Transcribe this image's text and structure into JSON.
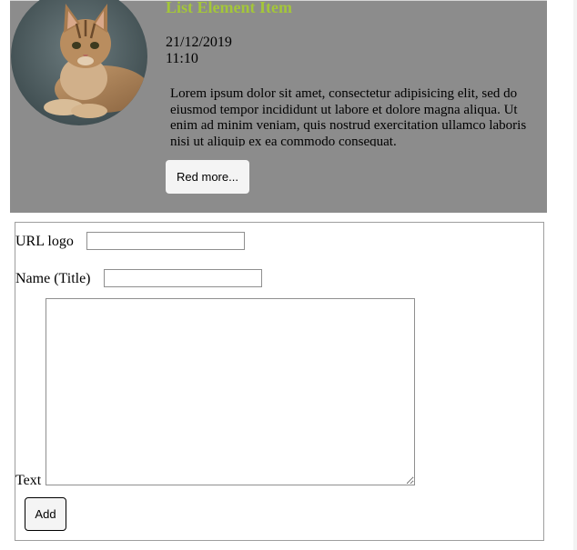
{
  "list_item": {
    "title": "List Element Item",
    "date": "21/12/2019",
    "time": "11:10",
    "text": "Lorem ipsum dolor sit amet, consectetur adipisicing elit, sed do eiusmod tempor incididunt ut labore et dolore magna aliqua. Ut enim ad minim veniam, quis nostrud exercitation ullamco laboris nisi ut aliquip ex ea commodo consequat.",
    "read_more_label": "Red more...",
    "image_icon": "cat-photo",
    "card_color": "#8c8c8c",
    "title_color": "#a4c639"
  },
  "form": {
    "url_label": "URL logo",
    "url_value": "",
    "name_label": "Name (Title)",
    "name_value": "",
    "text_label": "Text",
    "text_value": "",
    "add_label": "Add"
  }
}
